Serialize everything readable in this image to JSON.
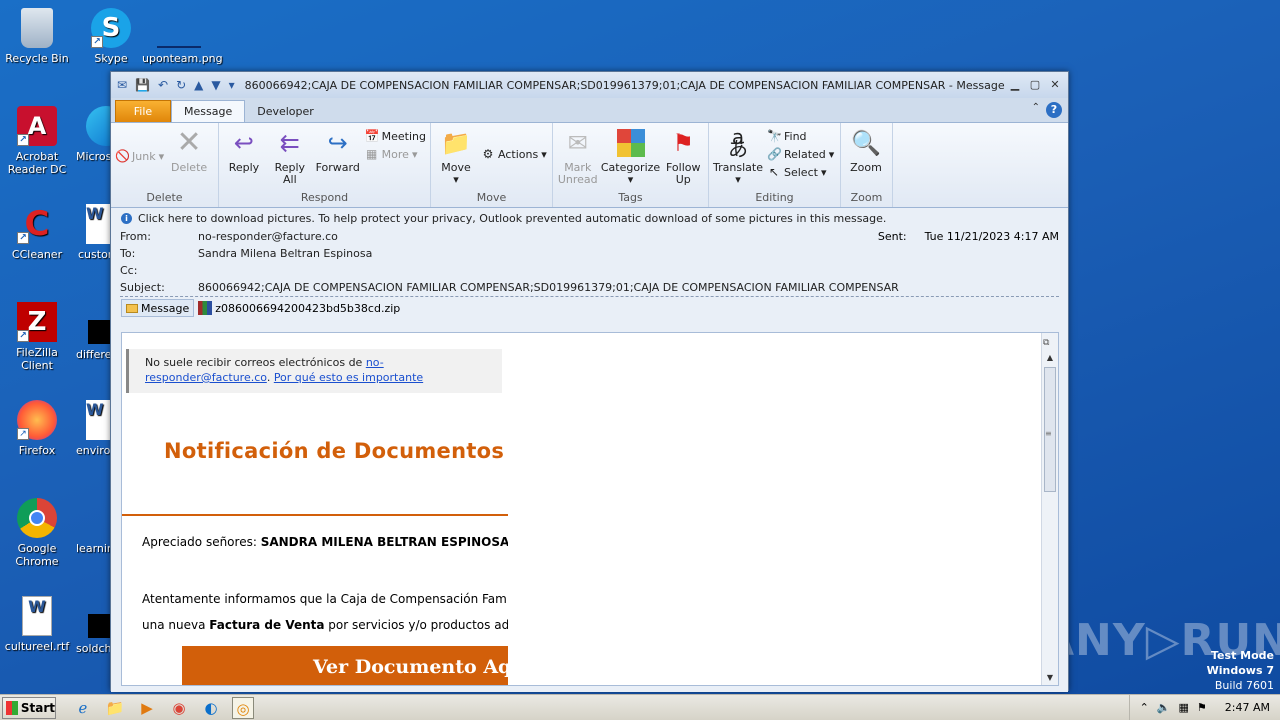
{
  "desktop": {
    "icons": [
      {
        "label": "Recycle Bin",
        "glyph": "🗑"
      },
      {
        "label": "Skype",
        "glyph": "S"
      },
      {
        "label": "uponteam.png",
        "glyph": ""
      },
      {
        "label": "Acrobat Reader DC",
        "glyph": "A"
      },
      {
        "label": "Microso",
        "glyph": "e"
      },
      {
        "label": "CCleaner",
        "glyph": "C"
      },
      {
        "label": "custom",
        "glyph": "W"
      },
      {
        "label": "FileZilla Client",
        "glyph": "Z"
      },
      {
        "label": "differe",
        "glyph": ""
      },
      {
        "label": "Firefox",
        "glyph": "🦊"
      },
      {
        "label": "enviro",
        "glyph": "W"
      },
      {
        "label": "Google Chrome",
        "glyph": "◉"
      },
      {
        "label": "learnin",
        "glyph": ""
      },
      {
        "label": "cultureel.rtf",
        "glyph": "W"
      },
      {
        "label": "soldchi",
        "glyph": ""
      }
    ],
    "watermark": "ANY▷RUN",
    "testmode": {
      "line1": "Test Mode",
      "line2": "Windows 7",
      "line3": "Build 7601"
    }
  },
  "window": {
    "title": "860066942;CAJA DE COMPENSACION FAMILIAR COMPENSAR;SD019961379;01;CAJA DE COMPENSACION FAMILIAR COMPENSAR - Message (...",
    "tabs": {
      "file": "File",
      "message": "Message",
      "developer": "Developer"
    },
    "ribbon": {
      "delete": {
        "label": "Delete",
        "junk": "Junk",
        "delete_btn": "Delete"
      },
      "respond": {
        "label": "Respond",
        "reply": "Reply",
        "reply_all": "Reply All",
        "forward": "Forward",
        "meeting": "Meeting",
        "more": "More"
      },
      "move": {
        "label": "Move",
        "move_btn": "Move",
        "actions": "Actions"
      },
      "tags": {
        "label": "Tags",
        "mark_unread": "Mark Unread",
        "categorize": "Categorize",
        "follow_up": "Follow Up"
      },
      "editing": {
        "label": "Editing",
        "translate": "Translate",
        "find": "Find",
        "related": "Related",
        "select": "Select"
      },
      "zoom": {
        "label": "Zoom",
        "zoom_btn": "Zoom"
      }
    }
  },
  "message": {
    "infobar": "Click here to download pictures. To help protect your privacy, Outlook prevented automatic download of some pictures in this message.",
    "from_label": "From:",
    "from": "no-responder@facture.co",
    "to_label": "To:",
    "to": "Sandra Milena Beltran Espinosa",
    "cc_label": "Cc:",
    "cc": "",
    "subject_label": "Subject:",
    "subject": "860066942;CAJA DE COMPENSACION FAMILIAR COMPENSAR;SD019961379;01;CAJA DE COMPENSACION FAMILIAR COMPENSAR",
    "sent_label": "Sent:",
    "sent": "Tue 11/21/2023 4:17 AM",
    "attach_message": "Message",
    "attachment": "z086006694200423bd5b38cd.zip"
  },
  "body": {
    "notice_text": "No suele recibir correos electrónicos de ",
    "notice_link1": "no-",
    "notice_link2": "responder@facture.co",
    "notice_sep": ". ",
    "notice_link3": "Por qué esto es importante",
    "title": "Notificación de Documentos",
    "greeting_prefix": "Apreciado señores: ",
    "greeting_name": "SANDRA MILENA BELTRAN ESPINOSA",
    "greeting_suffix": ",",
    "para_line1": "Atentamente informamos que la Caja de Compensación Fam",
    "para_line2_prefix": "una nueva ",
    "para_line2_bold": "Factura de Venta",
    "para_line2_suffix": " por servicios y/o productos adqu",
    "cta": "Ver Documento Aq"
  },
  "taskbar": {
    "start": "Start",
    "clock": "2:47 AM"
  }
}
